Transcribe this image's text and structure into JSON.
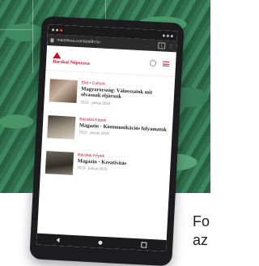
{
  "browser": {
    "url": "mantekva.com/a/a9b.hu",
    "tab_count": "1"
  },
  "site": {
    "logo_text": "Bácskai Népszava",
    "articles": [
      {
        "category": "Élet • Culture",
        "title": "Magyarország: Válasszatok mit olvasnak eljárunk",
        "date": "2023 · június 2023"
      },
      {
        "category": "Bácskai Képek",
        "title": "Magazin · Kommunikációs folyamatok",
        "date": "2023 · június 2023"
      },
      {
        "category": "Bácskai Képek",
        "title": "Magazin · Kreativitás",
        "date": "2023 · június 2023"
      }
    ]
  },
  "caption": {
    "line1": "Fo",
    "line2": "az"
  },
  "colors": {
    "accent": "#c8102e",
    "bezel": "#1c1c1e"
  }
}
